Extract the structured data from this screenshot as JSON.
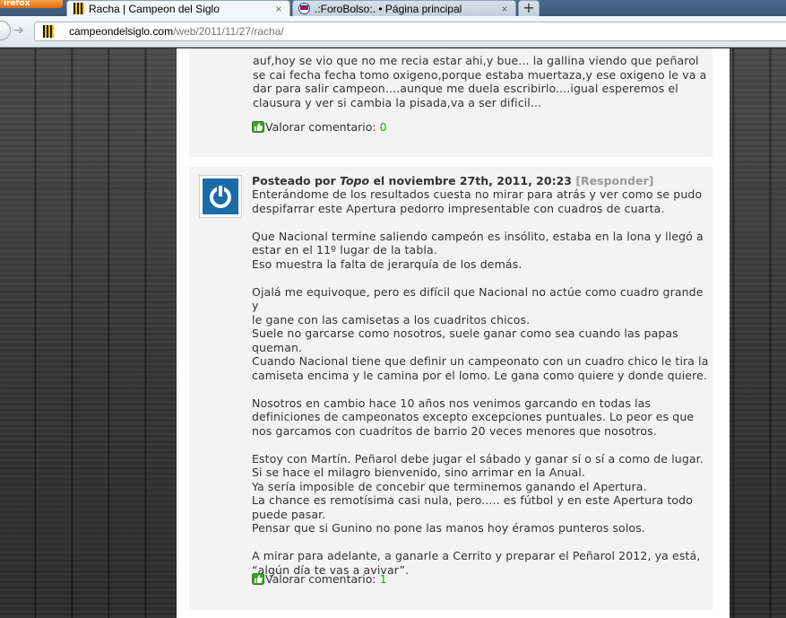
{
  "browser": {
    "firefox_button_label": "irefox",
    "tabs": [
      {
        "title": "Racha | Campeon del Siglo",
        "active": true
      },
      {
        "title": ".:ForoBolso:. • Página principal",
        "active": false
      }
    ],
    "url_domain": "campeondelsiglo.com",
    "url_path": "/web/2011/11/27/racha/"
  },
  "comment1": {
    "lines": [
      "auf,hoy se vio que no me recia estar ahi,y bue... la gallina viendo que peñarol",
      "se cai fecha fecha tomo oxigeno,porque estaba muertaza,y ese oxigeno le va a",
      "dar para salir campeon....aunque me duela escribirlo....igual esperemos el",
      "clausura y ver si cambia la pisada,va a ser dificil..."
    ],
    "rate_label": "Valorar comentario:",
    "rate_count": "0"
  },
  "comment2": {
    "posted_by": "Posteado por",
    "author": "Topo",
    "date": "el noviembre 27th, 2011, 20:23",
    "reply_label": "[Responder]",
    "paragraphs": [
      [
        "Enterándome de los resultados cuesta no mirar para atrás y ver como se pudo",
        "despifarrar este Apertura pedorro impresentable con cuadros de cuarta."
      ],
      [
        "Que Nacional termine saliendo campeón es insólito, estaba en la lona y llegó a",
        "estar en el 11º lugar de la tabla.",
        "Eso muestra la falta de jerarquía de los demás."
      ],
      [
        "Ojalá me equivoque, pero es difícil que Nacional no actúe como cuadro grande y",
        "le gane con las camisetas a los cuadritos chicos.",
        "Suele no garcarse como nosotros, suele ganar como sea cuando las papas",
        "queman.",
        "Cuando Nacional tiene que definir un campeonato con un cuadro chico le tira la",
        "camiseta encima y le camina por el lomo. Le gana como quiere y donde quiere."
      ],
      [
        "Nosotros en cambio hace 10 años nos venimos garcando en todas las",
        "definiciones de campeonatos excepto excepciones puntuales. Lo peor es que",
        "nos garcamos con cuadritos de barrio 20 veces menores que nosotros."
      ],
      [
        "Estoy con Martín. Peñarol debe jugar el sábado y ganar sí o sí a como de lugar.",
        "Si se hace el milagro bienvenido, sino arrimar en la Anual.",
        "Ya sería imposible de concebir que terminemos ganando el Apertura.",
        "La chance es remotísima casi nula, pero..... es fútbol y en este Apertura todo",
        "puede pasar.",
        "Pensar que si Gunino no pone las manos hoy éramos punteros solos."
      ],
      [
        "A mirar para adelante, a ganarle a Cerrito y preparar el Peñarol 2012, ya está,",
        "“algún día te vas a avivar”."
      ]
    ],
    "rate_label": "Valorar comentario:",
    "rate_count": "1"
  }
}
